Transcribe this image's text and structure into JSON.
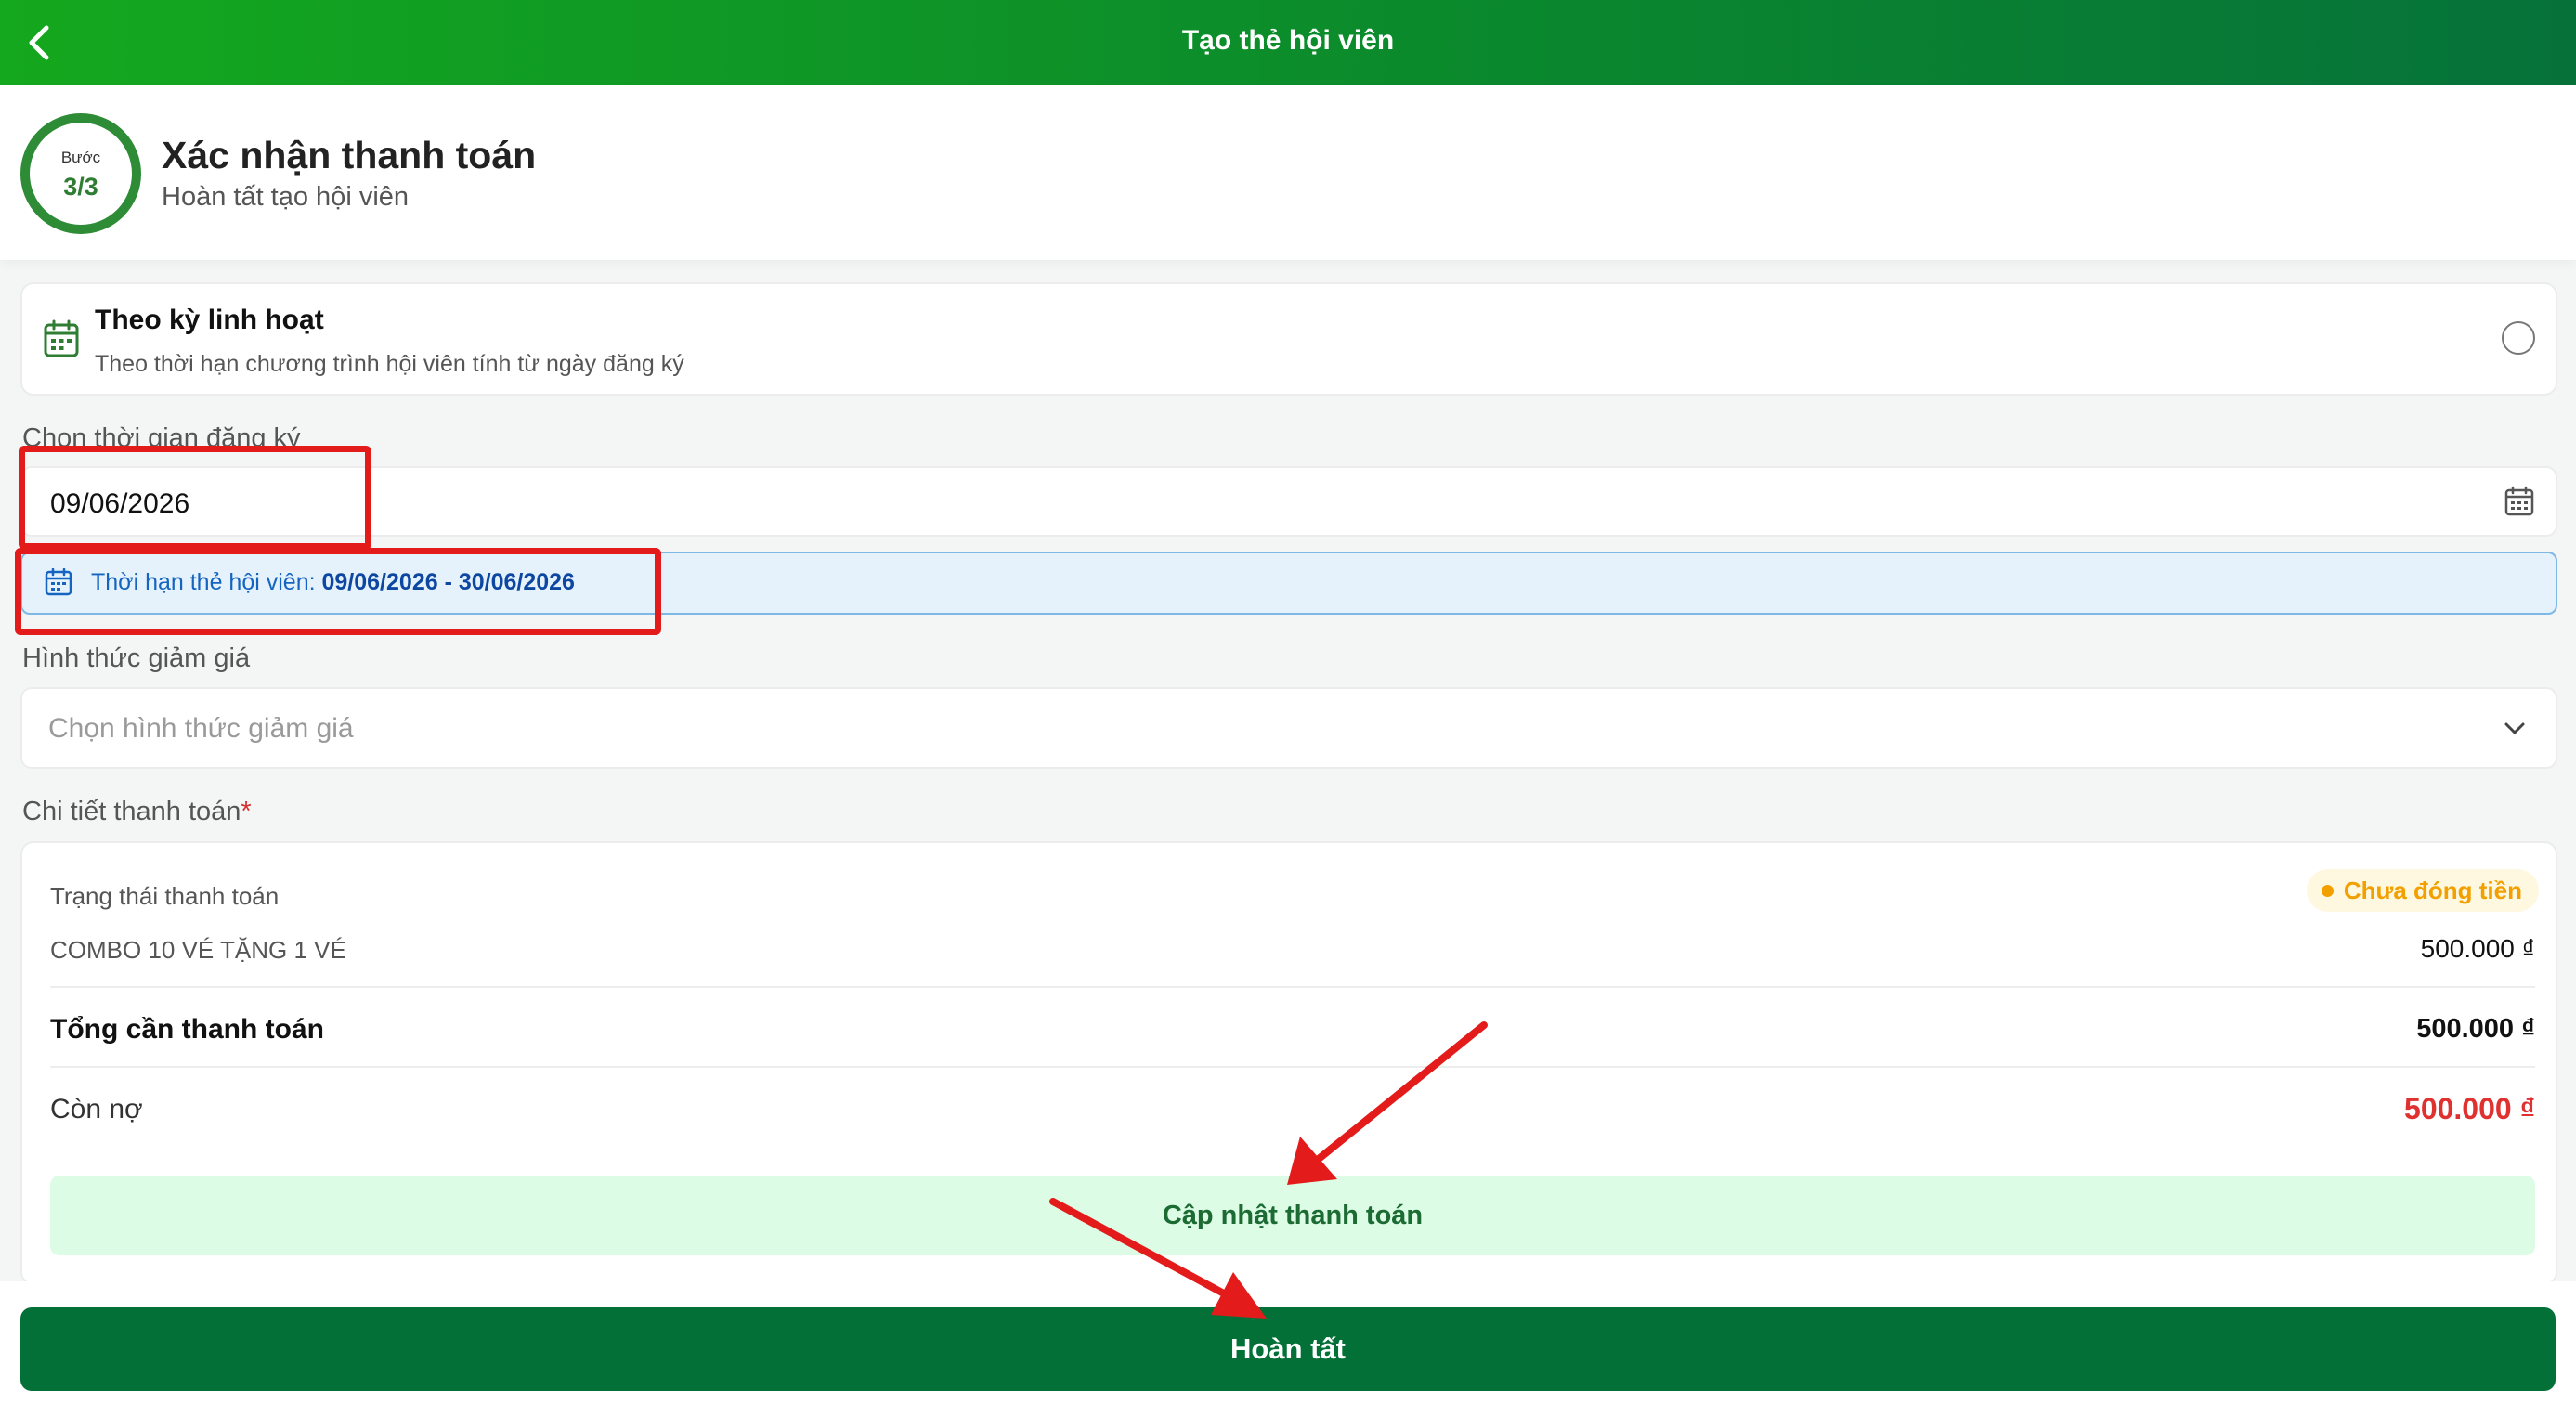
{
  "header": {
    "title": "Tạo thẻ hội viên"
  },
  "step": {
    "label": "Bước",
    "count": "3/3",
    "title": "Xác nhận thanh toán",
    "subtitle": "Hoàn tất tạo hội viên"
  },
  "plan_option": {
    "title": "Theo kỳ linh hoạt",
    "description": "Theo thời hạn chương trình hội viên tính từ ngày đăng ký",
    "selected": false
  },
  "registration": {
    "label": "Chọn thời gian đăng ký",
    "date": "09/06/2026",
    "period_prefix": "Thời hạn thẻ hội viên: ",
    "period_value": "09/06/2026 - 30/06/2026"
  },
  "discount": {
    "label": "Hình thức giảm giá",
    "placeholder": "Chọn hình thức giảm giá"
  },
  "payment": {
    "label": "Chi tiết thanh toán",
    "required_mark": "*",
    "status_label": "Trạng thái thanh toán",
    "status_badge": "Chưa đóng tiền",
    "status_color": "#f2a000",
    "item_name": "COMBO 10 VÉ TẶNG 1 VÉ",
    "item_price": "500.000 ₫",
    "total_label": "Tổng cần thanh toán",
    "total_value": "500.000 ₫",
    "debt_label": "Còn nợ",
    "debt_value": "500.000 ₫",
    "debt_color": "#e03131",
    "update_button": "Cập nhật thanh toán"
  },
  "footer": {
    "finish_button": "Hoàn tất"
  },
  "icons": {
    "back": "chevron-left-icon",
    "plan": "calendar-icon",
    "date_picker": "calendar-icon",
    "period": "calendar-icon",
    "select": "chevron-down-icon"
  },
  "colors": {
    "brand_green": "#037038",
    "header_gradient_start": "#14a81e",
    "annotation_red": "#e41b1b"
  }
}
